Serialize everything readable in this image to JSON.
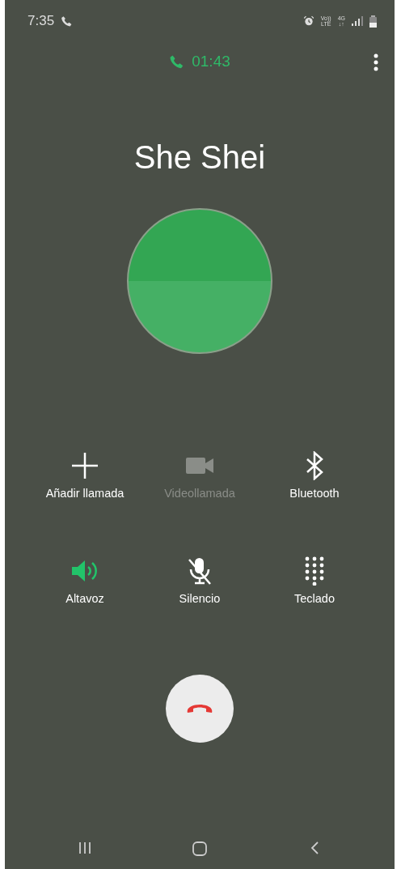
{
  "status_bar": {
    "time": "7:35",
    "volte": {
      "top": "Vo))",
      "bottom": "LTE"
    },
    "network": {
      "top": "4G",
      "bottom": "↓↑"
    }
  },
  "call": {
    "duration": "01:43",
    "contact_name": "She Shei"
  },
  "actions": [
    {
      "kind": "add",
      "label": "Añadir llamada",
      "disabled": false,
      "on": false
    },
    {
      "kind": "video",
      "label": "Videollamada",
      "disabled": true,
      "on": false
    },
    {
      "kind": "bluetooth",
      "label": "Bluetooth",
      "disabled": false,
      "on": false
    },
    {
      "kind": "speaker",
      "label": "Altavoz",
      "disabled": false,
      "on": true
    },
    {
      "kind": "mute",
      "label": "Silencio",
      "disabled": false,
      "on": false
    },
    {
      "kind": "keypad",
      "label": "Teclado",
      "disabled": false,
      "on": false
    }
  ]
}
